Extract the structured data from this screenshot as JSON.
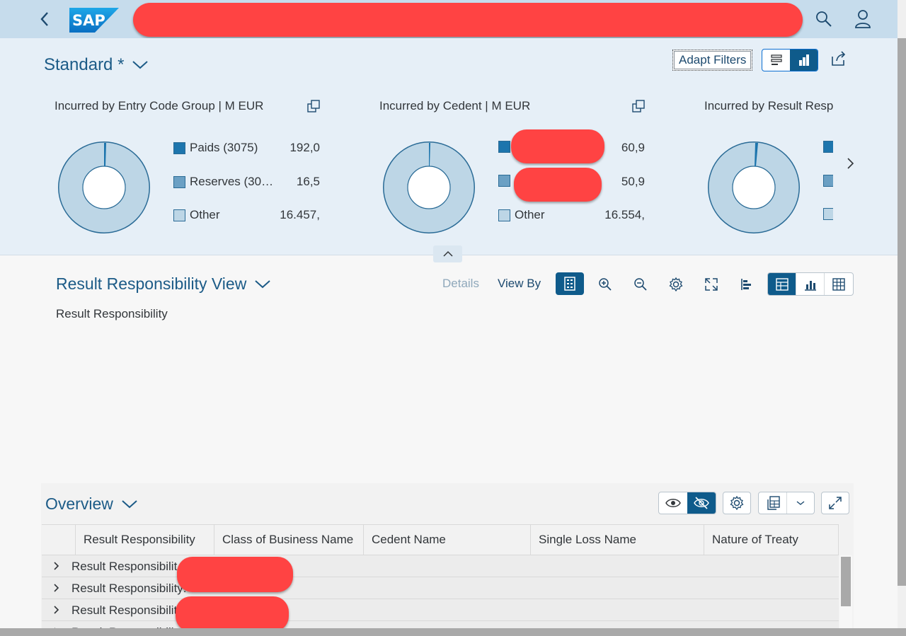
{
  "shell": {
    "logo_text": "SAP",
    "colors": {
      "bar": "#c6dcec",
      "logo": "#1a8fd4"
    }
  },
  "header": {
    "variant_label": "Standard *",
    "adapt_filters_label": "Adapt Filters",
    "cards": [
      {
        "title": "Incurred by Entry Code Group   | M EUR",
        "legend": [
          {
            "label": "Paids (3075)",
            "value": "192,0"
          },
          {
            "label": "Reserves (30…",
            "value": "16,5"
          },
          {
            "label": "Other",
            "value": "16.457,"
          }
        ]
      },
      {
        "title": "Incurred by Cedent   | M EUR",
        "legend": [
          {
            "label": "",
            "value": "60,9"
          },
          {
            "label": "",
            "value": "50,9"
          },
          {
            "label": "Other",
            "value": "16.554,"
          }
        ]
      },
      {
        "title": "Incurred by Result Resp",
        "legend": [
          {
            "label": "",
            "value": ""
          },
          {
            "label": "",
            "value": ""
          },
          {
            "label": "",
            "value": ""
          }
        ]
      }
    ]
  },
  "result_view": {
    "title": "Result Responsibility View",
    "subtitle": "Result Responsibility",
    "details_label": "Details",
    "view_by_label": "View By"
  },
  "overview": {
    "title": "Overview",
    "columns": [
      "Result Responsibility",
      "Class of Business Name",
      "Cedent Name",
      "Single Loss Name",
      "Nature of Treaty"
    ],
    "rows": [
      {
        "label": "Result Responsibilit"
      },
      {
        "label": "Result Responsibility: 0001"
      },
      {
        "label": "Result Responsibilit"
      },
      {
        "label": "Result Responsibilit"
      }
    ]
  }
}
